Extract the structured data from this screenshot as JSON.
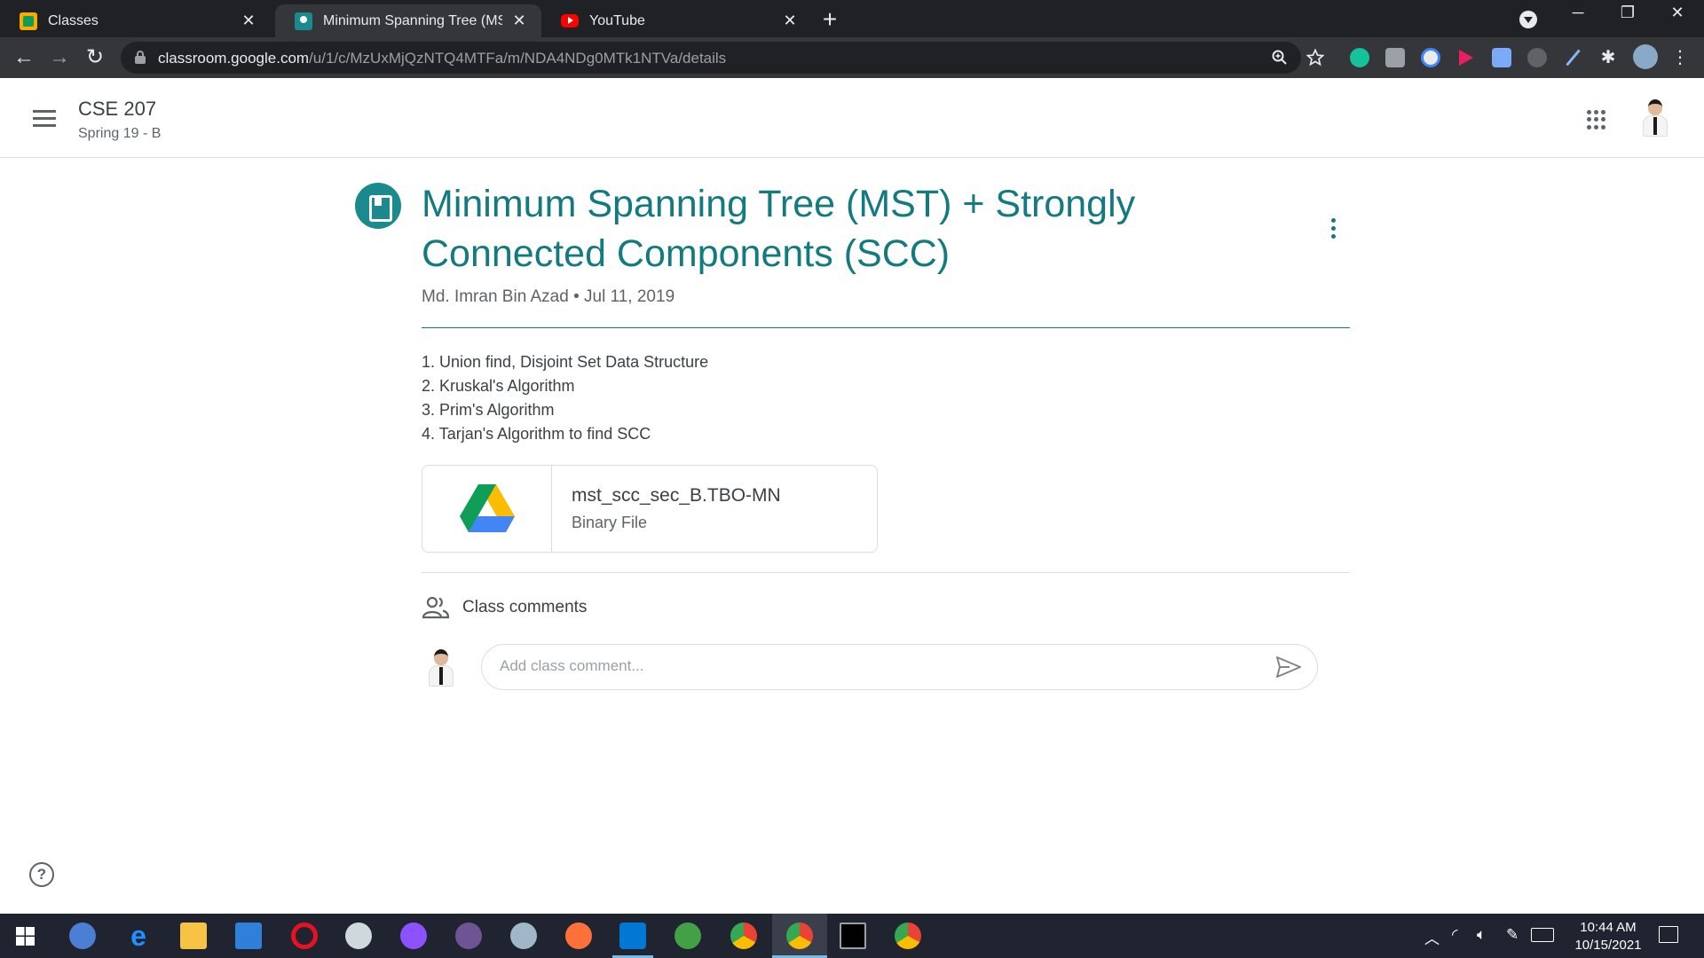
{
  "browser": {
    "tabs": [
      {
        "label": "Classes",
        "active": false
      },
      {
        "label": "Minimum Spanning Tree (MST) + S",
        "active": true
      },
      {
        "label": "YouTube",
        "active": false
      }
    ],
    "new_tab": "+",
    "close_glyph": "✕",
    "url_host": "classroom.google.com",
    "url_path": "/u/1/c/MzUxMjQzNTQ4MTFa/m/NDA4NDg0MTk1NTVa/details",
    "window_controls": {
      "minimize": "─",
      "restore": "❐",
      "close": "✕"
    }
  },
  "header": {
    "class_name": "CSE 207",
    "class_section": "Spring 19 - B"
  },
  "post": {
    "title": "Minimum Spanning Tree (MST) + Strongly Connected Components (SCC)",
    "author": "Md. Imran Bin Azad",
    "separator": "•",
    "date": "Jul 11, 2019",
    "description": [
      "1. Union find, Disjoint Set Data Structure",
      "2. Kruskal's Algorithm",
      "3. Prim's Algorithm",
      "4. Tarjan's Algorithm to find SCC"
    ],
    "attachment": {
      "name": "mst_scc_sec_B.TBO-MN",
      "type": "Binary File",
      "icon": "google-drive-icon"
    }
  },
  "comments": {
    "title": "Class comments",
    "placeholder": "Add class comment..."
  },
  "help": "?",
  "taskbar": {
    "time": "10:44 AM",
    "date": "10/15/2021"
  },
  "colors": {
    "accent": "#137a7f",
    "chrome_dark": "#202124",
    "chrome_toolbar": "#35363a",
    "taskbar": "#1f2430"
  }
}
